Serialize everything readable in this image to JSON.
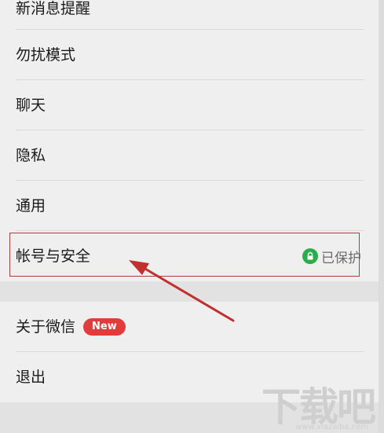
{
  "settings": {
    "items": [
      {
        "label": "新消息提醒"
      },
      {
        "label": "勿扰模式"
      },
      {
        "label": "聊天"
      },
      {
        "label": "隐私"
      },
      {
        "label": "通用"
      },
      {
        "label": "帐号与安全",
        "status": "已保护"
      }
    ],
    "group2": [
      {
        "label": "关于微信",
        "badge": "New"
      },
      {
        "label": "退出"
      }
    ]
  },
  "icons": {
    "status_icon": "lock-icon"
  },
  "colors": {
    "badge_red": "#e23b3b",
    "protect_green": "#2aad4a",
    "annotation_red": "#c0302f"
  },
  "watermark": {
    "logo": "下载吧",
    "url": "www.xiazaiba.com"
  }
}
